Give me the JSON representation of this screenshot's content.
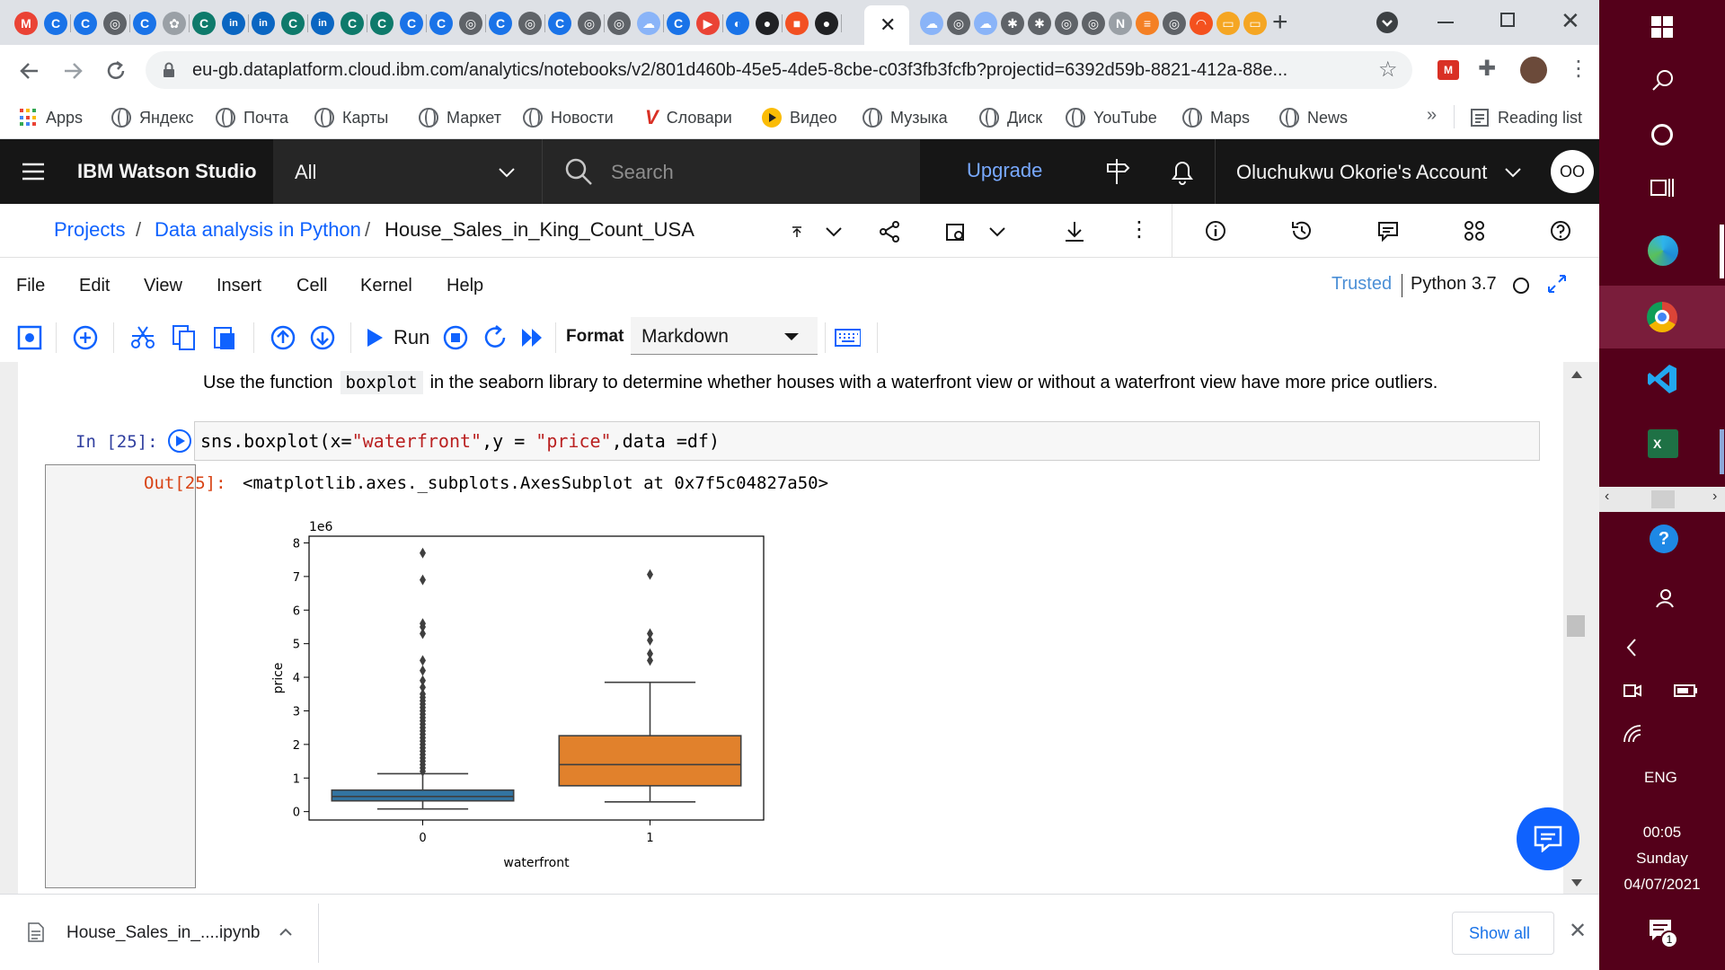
{
  "browser": {
    "url": "eu-gb.dataplatform.cloud.ibm.com/analytics/notebooks/v2/801d460b-45e5-4de5-8cbe-c03f3fb3fcfb?projectid=6392d59b-8821-412a-88e...",
    "bookmarks": [
      {
        "label": "Apps"
      },
      {
        "label": "Яндекс"
      },
      {
        "label": "Почта"
      },
      {
        "label": "Карты"
      },
      {
        "label": "Маркет"
      },
      {
        "label": "Новости"
      },
      {
        "label": "Словари"
      },
      {
        "label": "Видео"
      },
      {
        "label": "Музыка"
      },
      {
        "label": "Диск"
      },
      {
        "label": "YouTube"
      },
      {
        "label": "Maps"
      },
      {
        "label": "News"
      }
    ],
    "reading_list": "Reading list",
    "more": "»"
  },
  "watson": {
    "brand": "IBM Watson Studio",
    "scope": "All",
    "search_placeholder": "Search",
    "upgrade": "Upgrade",
    "account": "Oluchukwu Okorie's Account",
    "avatar": "OO"
  },
  "breadcrumb": {
    "projects": "Projects",
    "project": "Data analysis in Python",
    "notebook": "House_Sales_in_King_Count_USA",
    "sep": "/"
  },
  "menu": {
    "items": [
      "File",
      "Edit",
      "View",
      "Insert",
      "Cell",
      "Kernel",
      "Help"
    ],
    "trusted": "Trusted",
    "kernel": "Python 3.7"
  },
  "toolbar": {
    "run": "Run",
    "format_label": "Format",
    "format_value": "Markdown"
  },
  "notebook": {
    "md_pre": "Use the function",
    "md_code": "boxplot",
    "md_post": "in the seaborn library to determine whether houses with a waterfront view or without a waterfront view have more price outliers.",
    "in_prompt": "In [25]:",
    "code_parts": [
      "sns.boxplot(x=",
      "\"waterfront\"",
      ",y = ",
      "\"price\"",
      ",data =df)"
    ],
    "out_prompt": "Out[25]:",
    "output_text": "<matplotlib.axes._subplots.AxesSubplot at 0x7f5c04827a50>"
  },
  "chart_data": {
    "type": "boxplot",
    "categories": [
      "0",
      "1"
    ],
    "xlabel": "waterfront",
    "ylabel": "price",
    "offset_label": "1e6",
    "ylim": [
      -0.25,
      8.2
    ],
    "yticks": [
      0,
      1,
      2,
      3,
      4,
      5,
      6,
      7,
      8
    ],
    "series": [
      {
        "category": "0",
        "color": "#3274a1",
        "q1": 0.32,
        "median": 0.45,
        "q3": 0.64,
        "whisker_low": 0.08,
        "whisker_high": 1.13,
        "outliers": [
          1.2,
          1.3,
          1.4,
          1.5,
          1.6,
          1.7,
          1.8,
          1.9,
          2.0,
          2.1,
          2.2,
          2.3,
          2.4,
          2.5,
          2.6,
          2.7,
          2.8,
          2.9,
          3.0,
          3.1,
          3.2,
          3.3,
          3.4,
          3.5,
          3.7,
          3.9,
          4.2,
          4.5,
          5.3,
          5.5,
          5.6,
          6.9,
          7.7
        ]
      },
      {
        "category": "1",
        "color": "#e1812c",
        "q1": 0.77,
        "median": 1.4,
        "q3": 2.26,
        "whisker_low": 0.29,
        "whisker_high": 3.85,
        "outliers": [
          4.5,
          4.7,
          5.1,
          5.3,
          7.06
        ]
      }
    ]
  },
  "downloads": {
    "file": "House_Sales_in_....ipynb",
    "show_all": "Show all"
  },
  "taskbar": {
    "lang": "ENG",
    "time": "00:05",
    "day": "Sunday",
    "date": "04/07/2021",
    "notif_count": "1"
  },
  "colors": {
    "ibm_blue": "#0f62fe",
    "header_dark": "#161616",
    "taskbar": "#54001a"
  }
}
